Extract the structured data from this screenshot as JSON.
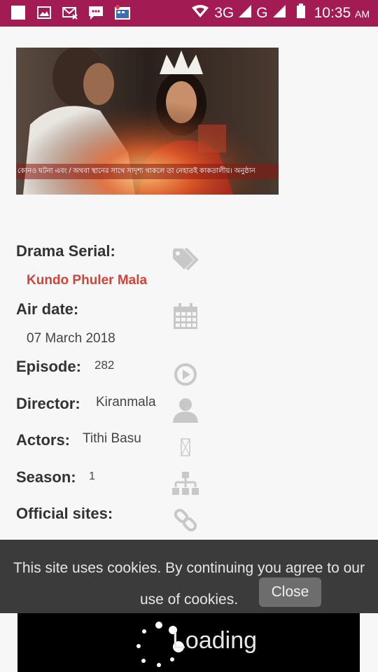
{
  "status_bar": {
    "network_3g": "3G",
    "network_g": "G",
    "time": "10:35",
    "ampm": "AM",
    "left_icons": [
      "square-icon",
      "image-icon",
      "mail-icon",
      "chat-icon",
      "calendar-icon"
    ],
    "right_icons": [
      "wifi-icon",
      "signal-icon",
      "signal-icon",
      "battery-icon"
    ]
  },
  "video": {
    "subtitle_text": "কোনও ঘটনা এবং / অথবা স্থানের সাথে সাদৃশ্য থাকলে তা নেহাতই কাকতালীয়। অনুষ্ঠান"
  },
  "details": {
    "drama_label": "Drama Serial:",
    "drama_value": "Kundo Phuler Mala",
    "airdate_label": "Air date:",
    "airdate_value": "07 March 2018",
    "episode_label": "Episode:",
    "episode_value": "282",
    "director_label": "Director:",
    "director_value": "Kiranmala",
    "actors_label": "Actors:",
    "actors_value": "Tithi Basu",
    "season_label": "Season:",
    "season_value": "1",
    "sites_label": "Official sites:"
  },
  "cookie": {
    "text": "This site uses cookies. By continuing you agree to our use of cookies.",
    "close": "Close"
  },
  "loading": {
    "text": "Loading"
  }
}
